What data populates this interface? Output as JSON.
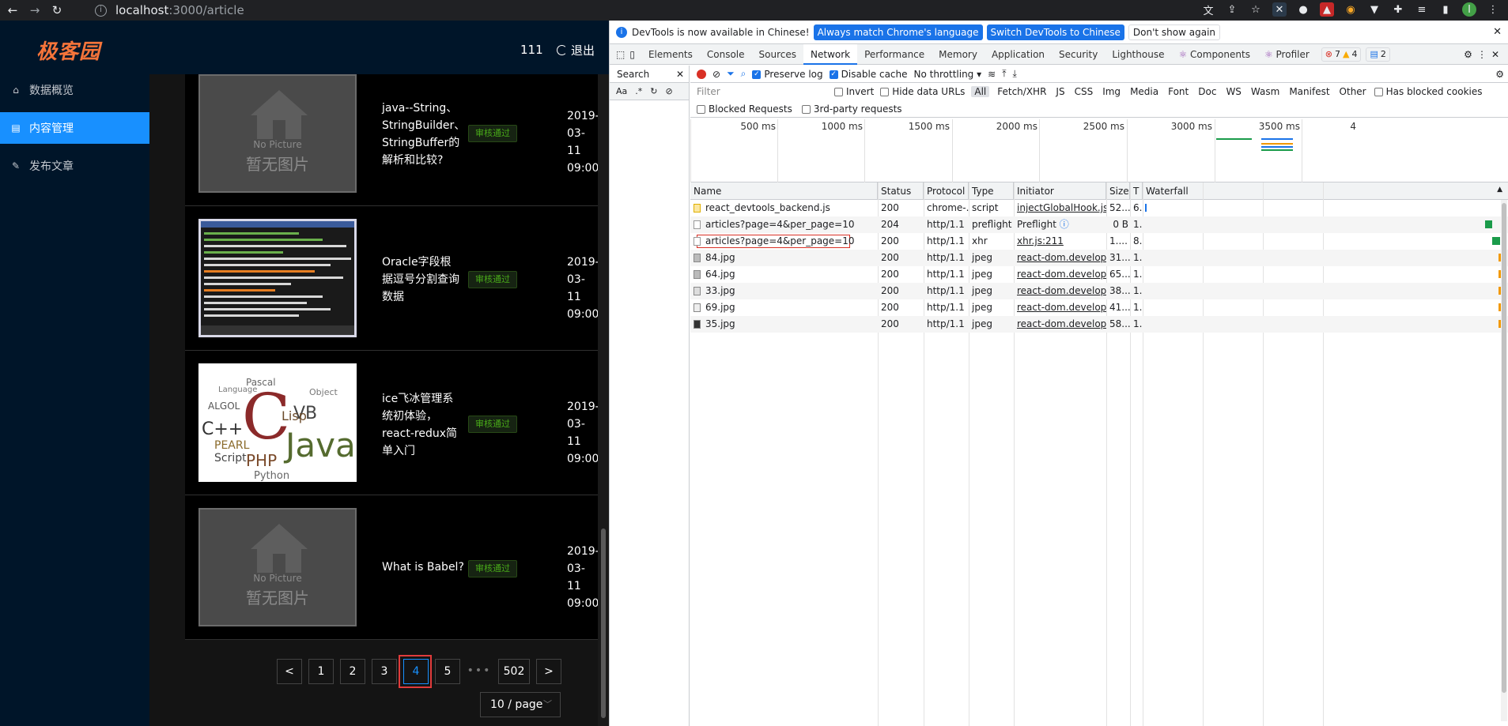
{
  "browser": {
    "back": "←",
    "forward": "→",
    "reload": "↻",
    "url_host": "localhost",
    "url_path": ":3000/article"
  },
  "app": {
    "logo": "极客园",
    "user_name": "111",
    "logout_label": "退出",
    "menu": [
      {
        "label": "数据概览",
        "icon": "home-icon"
      },
      {
        "label": "内容管理",
        "icon": "document-icon",
        "active": true
      },
      {
        "label": "发布文章",
        "icon": "edit-icon"
      }
    ],
    "articles": [
      {
        "title": "java--String、StringBuilder、StringBuffer的解析和比较?",
        "status": "审核通过",
        "date": "2019-03-11 09:00",
        "cover": "nopic"
      },
      {
        "title": "Oracle字段根据逗号分割查询数据",
        "status": "审核通过",
        "date": "2019-03-11 09:00",
        "cover": "code"
      },
      {
        "title": "ice飞冰管理系统初体验，react-redux简单入门",
        "status": "审核通过",
        "date": "2019-03-11 09:00",
        "cover": "wordcloud"
      },
      {
        "title": "What is Babel?",
        "status": "审核通过",
        "date": "2019-03-11 09:00",
        "cover": "nopic"
      }
    ],
    "nopic_en": "No Picture",
    "nopic_zh": "暂无图片",
    "pagination": {
      "prev": "<",
      "pages": [
        "1",
        "2",
        "3",
        "4",
        "5"
      ],
      "current": "4",
      "ellipsis": "•••",
      "last": "502",
      "next": ">",
      "page_size": "10 / page"
    }
  },
  "devtools": {
    "lang_bar": {
      "message": "DevTools is now available in Chinese!",
      "btn_match": "Always match Chrome's language",
      "btn_switch": "Switch DevTools to Chinese",
      "btn_dont": "Don't show again"
    },
    "tabs": [
      "Elements",
      "Console",
      "Sources",
      "Network",
      "Performance",
      "Memory",
      "Application",
      "Security",
      "Lighthouse",
      "Components",
      "Profiler"
    ],
    "active_tab": "Network",
    "issues": {
      "errors": "7",
      "warnings": "4",
      "messages": "2"
    },
    "search_label": "Search",
    "search_opts": [
      "Aa",
      ".*"
    ],
    "toolbar": {
      "preserve_log": "Preserve log",
      "disable_cache": "Disable cache",
      "throttling": "No throttling"
    },
    "filter": {
      "placeholder": "Filter",
      "invert": "Invert",
      "hide_data_urls": "Hide data URLs",
      "types": [
        "All",
        "Fetch/XHR",
        "JS",
        "CSS",
        "Img",
        "Media",
        "Font",
        "Doc",
        "WS",
        "Wasm",
        "Manifest",
        "Other"
      ],
      "has_blocked_cookies": "Has blocked cookies",
      "blocked_requests": "Blocked Requests",
      "third_party": "3rd-party requests"
    },
    "timeline_labels": [
      "500 ms",
      "1000 ms",
      "1500 ms",
      "2000 ms",
      "2500 ms",
      "3000 ms",
      "3500 ms",
      "4"
    ],
    "columns": [
      "Name",
      "Status",
      "Protocol",
      "Type",
      "Initiator",
      "Size",
      "T",
      "Waterfall"
    ],
    "requests": [
      {
        "name": "react_devtools_backend.js",
        "status": "200",
        "protocol": "chrome-...",
        "type": "script",
        "initiator": "injectGlobalHook.js:22...",
        "size": "52...",
        "time": "6...",
        "icon": "js"
      },
      {
        "name": "articles?page=4&per_page=10",
        "status": "204",
        "protocol": "http/1.1",
        "type": "preflight",
        "initiator": "Preflight",
        "size": "0 B",
        "time": "1...",
        "icon": "doc"
      },
      {
        "name": "articles?page=4&per_page=10",
        "status": "200",
        "protocol": "http/1.1",
        "type": "xhr",
        "initiator": "xhr.js:211",
        "size": "1....",
        "time": "8...",
        "icon": "doc",
        "highlighted": true
      },
      {
        "name": "84.jpg",
        "status": "200",
        "protocol": "http/1.1",
        "type": "jpeg",
        "initiator": "react-dom.developme...",
        "size": "31...",
        "time": "1...",
        "icon": "img"
      },
      {
        "name": "64.jpg",
        "status": "200",
        "protocol": "http/1.1",
        "type": "jpeg",
        "initiator": "react-dom.developme...",
        "size": "65...",
        "time": "1...",
        "icon": "img"
      },
      {
        "name": "33.jpg",
        "status": "200",
        "protocol": "http/1.1",
        "type": "jpeg",
        "initiator": "react-dom.developme...",
        "size": "38...",
        "time": "1...",
        "icon": "img"
      },
      {
        "name": "69.jpg",
        "status": "200",
        "protocol": "http/1.1",
        "type": "jpeg",
        "initiator": "react-dom.developme...",
        "size": "41...",
        "time": "1...",
        "icon": "img"
      },
      {
        "name": "35.jpg",
        "status": "200",
        "protocol": "http/1.1",
        "type": "jpeg",
        "initiator": "react-dom.developme...",
        "size": "58...",
        "time": "1...",
        "icon": "img"
      }
    ]
  },
  "colors": {
    "accent": "#1890ff",
    "logo": "#f5743a",
    "success": "#49aa19",
    "highlight": "#e03b3b"
  }
}
